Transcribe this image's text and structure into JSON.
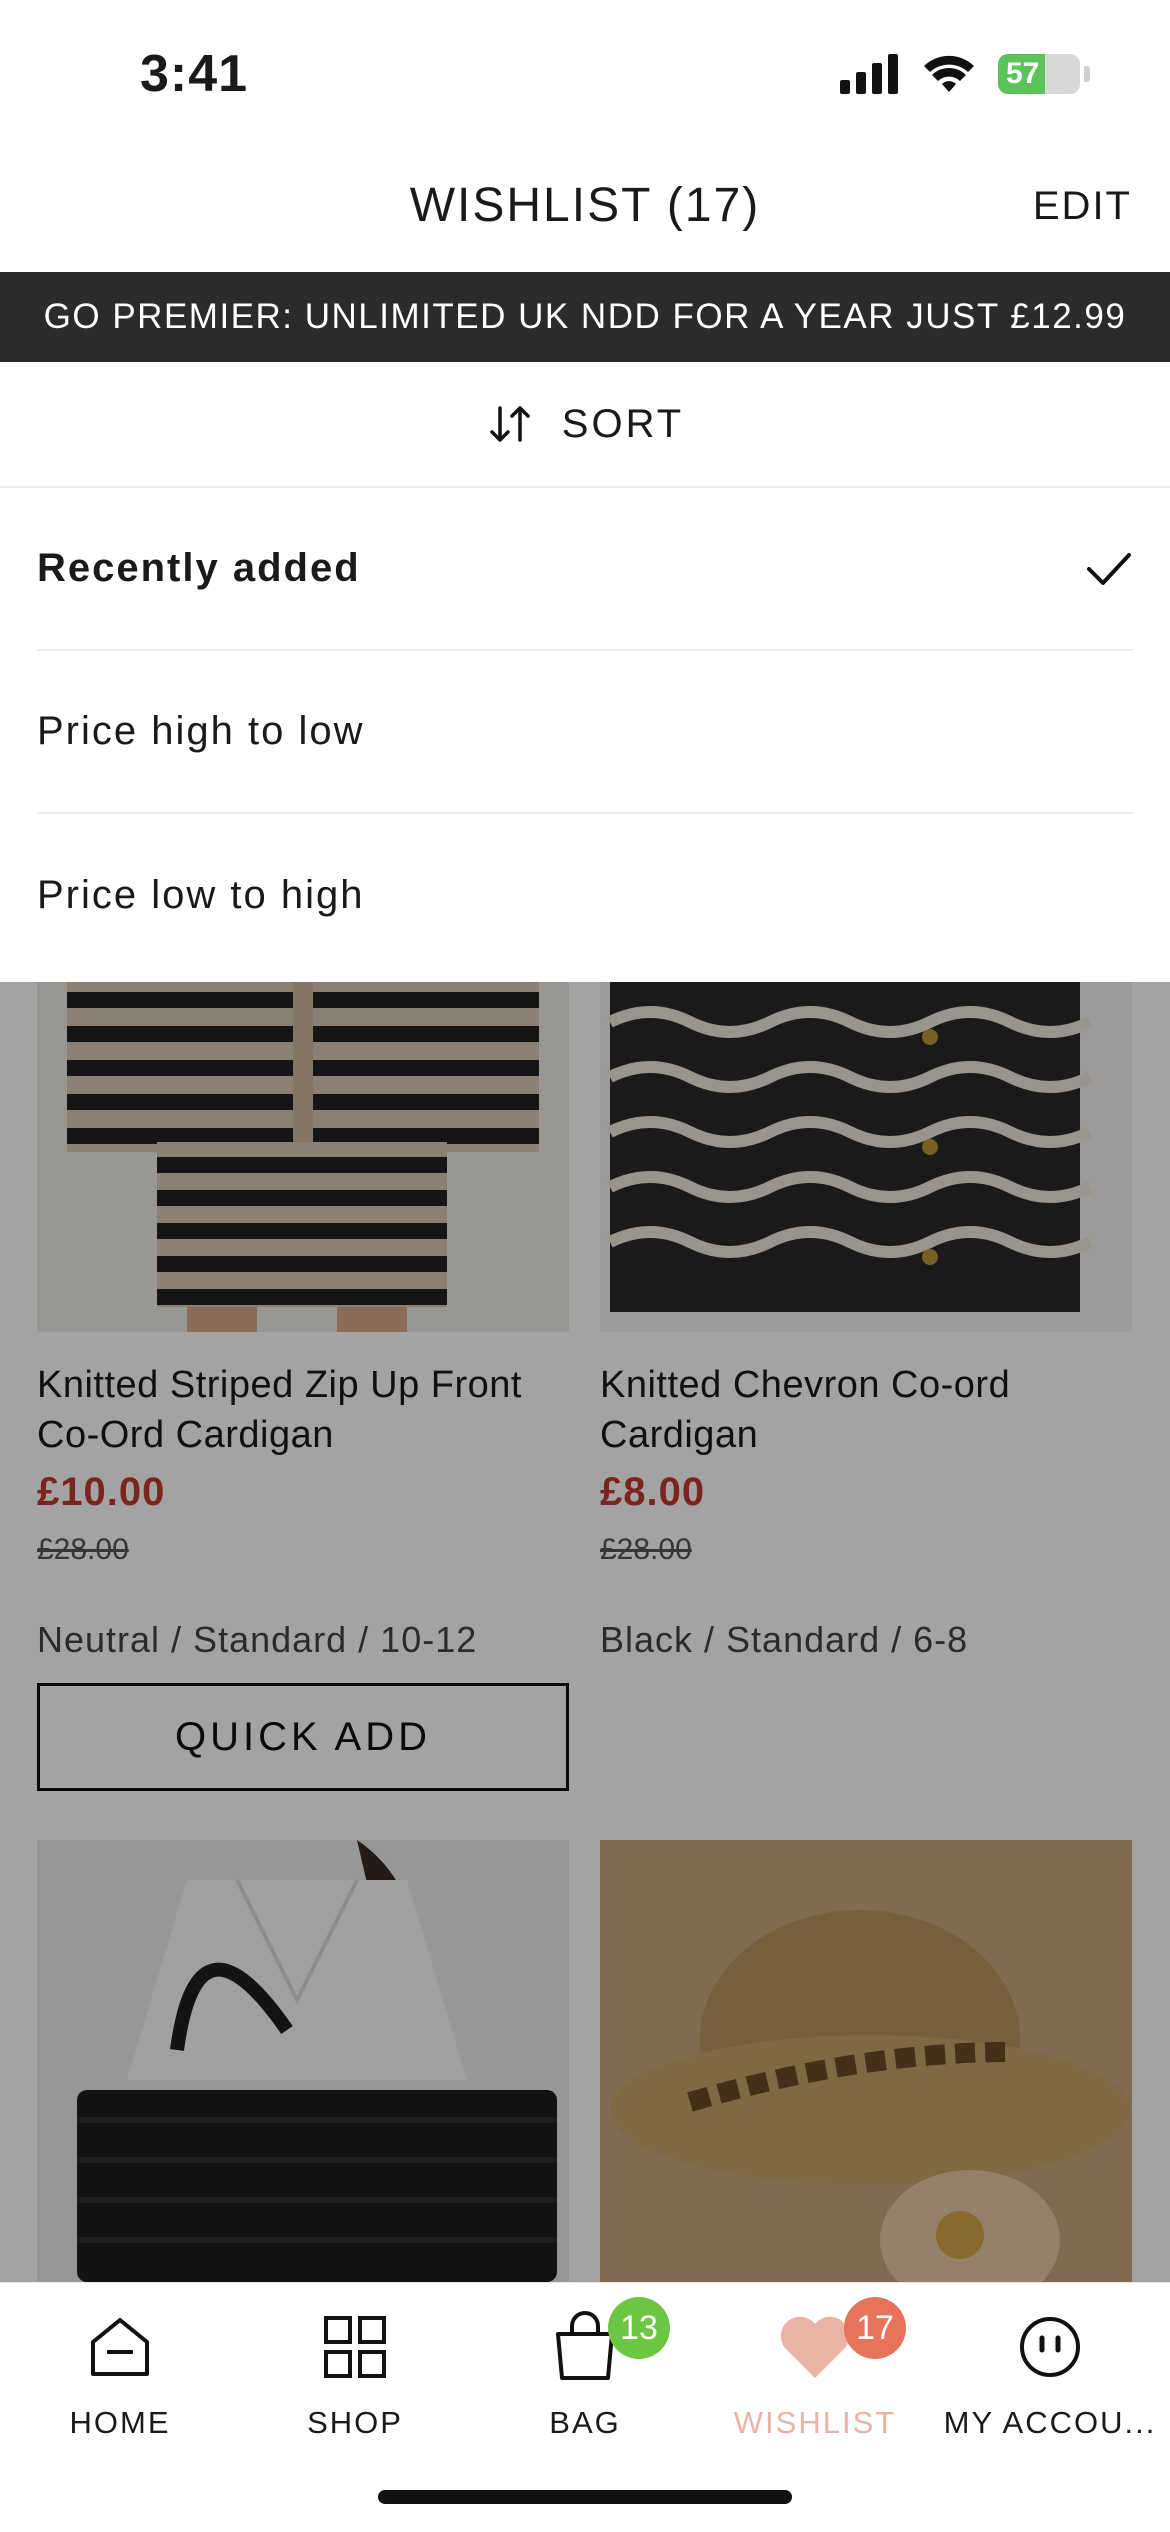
{
  "status_bar": {
    "time": "3:41",
    "battery": "57"
  },
  "header": {
    "title": "WISHLIST (17)",
    "edit_label": "EDIT"
  },
  "promo": {
    "text": "GO PREMIER: UNLIMITED UK NDD FOR A YEAR JUST £12.99"
  },
  "sort": {
    "header_label": "SORT",
    "options": [
      {
        "label": "Recently added",
        "selected": true
      },
      {
        "label": "Price high to low",
        "selected": false
      },
      {
        "label": "Price low to high",
        "selected": false
      }
    ]
  },
  "products": [
    {
      "title": "Knitted Striped Zip Up Front Co-Ord Cardigan",
      "price": "£10.00",
      "was_price": "£28.00",
      "variant": "Neutral / Standard / 10-12",
      "quick_add_label": "QUICK ADD"
    },
    {
      "title": "Knitted Chevron Co-ord Cardigan",
      "price": "£8.00",
      "was_price": "£28.00",
      "variant": "Black / Standard / 6-8"
    }
  ],
  "tabs": [
    {
      "label": "HOME",
      "icon": "home-icon"
    },
    {
      "label": "SHOP",
      "icon": "grid-icon"
    },
    {
      "label": "BAG",
      "icon": "bag-icon",
      "badge": "13"
    },
    {
      "label": "WISHLIST",
      "icon": "heart-icon",
      "badge": "17",
      "active": true
    },
    {
      "label": "MY ACCOU...",
      "icon": "account-icon"
    }
  ],
  "colors": {
    "accent": "#e6735c",
    "sale": "#c0392b",
    "bag_badge": "#6cc644",
    "active_tab": "#e9b3a6"
  }
}
